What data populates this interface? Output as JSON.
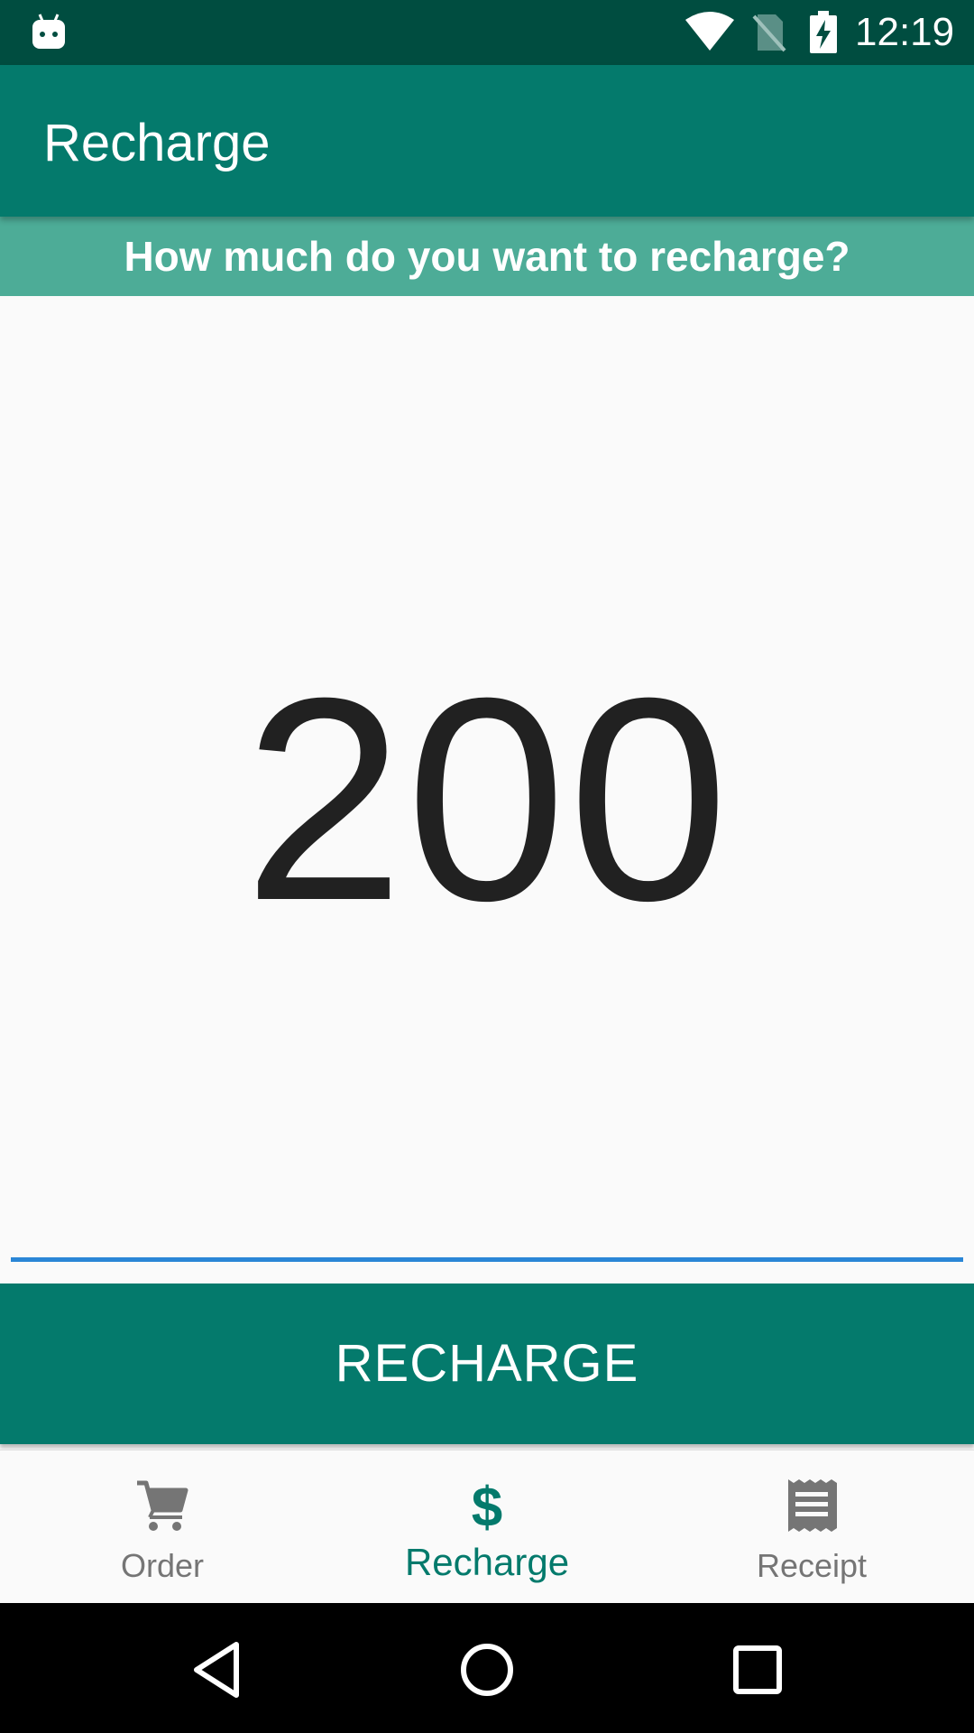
{
  "status_bar": {
    "time": "12:19",
    "icons": [
      "android-notification-icon",
      "wifi-icon",
      "no-sim-icon",
      "battery-charging-icon"
    ]
  },
  "app_bar": {
    "title": "Recharge"
  },
  "prompt": {
    "text": "How much do you want to recharge?"
  },
  "amount": {
    "value": "200"
  },
  "recharge_button": {
    "label": "RECHARGE"
  },
  "bottom_nav": {
    "items": [
      {
        "label": "Order",
        "icon": "shopping-cart-icon",
        "active": false
      },
      {
        "label": "Recharge",
        "icon": "dollar-icon",
        "active": true
      },
      {
        "label": "Receipt",
        "icon": "receipt-icon",
        "active": false
      }
    ]
  },
  "system_nav": {
    "icons": [
      "back-icon",
      "home-icon",
      "recents-icon"
    ]
  },
  "colors": {
    "status_bar": "#004d40",
    "primary": "#047a6c",
    "prompt_bar": "#4dac97",
    "underline": "#2a86d6",
    "inactive": "#757575"
  }
}
